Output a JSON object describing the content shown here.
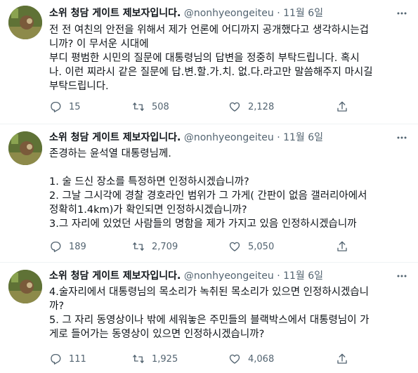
{
  "tweets": [
    {
      "name": "소위 청담 게이트 제보자입니다.",
      "handle": "@nonhyeongeiteu",
      "dot": "·",
      "date": "11월 6일",
      "lines": [
        "전 전 여친의 안전을 위해서 제가 언론에 어디까지 공개했다고 생각하시는겁",
        "니까? 이 무서운 시대에",
        "부디 평범한 시민의  질문에 대통령님의 답변을 정중히 부탁드립니다. 혹시",
        "나. 이런 찌라시 같은 질문에 답.변.할.가.치. 없.다.라고만 말씀해주지 마시길",
        "부탁드립니다."
      ],
      "replies": "15",
      "retweets": "508",
      "likes": "2,128"
    },
    {
      "name": "소위 청담 게이트 제보자입니다.",
      "handle": "@nonhyeongeiteu",
      "dot": "·",
      "date": "11월 6일",
      "lines": [
        "존경하는 윤석열 대통령님께.",
        "",
        "1. 술 드신 장소를 특정하면 인정하시겠습니까?",
        "2. 그날 그시각에 경찰 경호라인 범위가 그 가게( 간판이 없음 갤러리아에서",
        "정확히1.4km)가 확인되면 인정하시겠습니까?",
        "3.그 자리에 있었던 사람들의 명함을 제가 가지고 있음 인정하시겠습니까"
      ],
      "replies": "189",
      "retweets": "2,709",
      "likes": "5,050"
    },
    {
      "name": "소위 청담 게이트 제보자입니다.",
      "handle": "@nonhyeongeiteu",
      "dot": "·",
      "date": "11월 6일",
      "lines": [
        "4.술자리에서 대통령님의 목소리가 녹취된 목소리가 있으면 인정하시겠습니",
        "까?",
        "5. 그 자리 동영상이나 밖에 세워놓은 주민들의 블랙박스에서 대통령님이 가",
        "게로 들어가는 동영상이 있으면 인정하시겠습니까?"
      ],
      "replies": "111",
      "retweets": "1,925",
      "likes": "4,068"
    }
  ],
  "icons": {
    "reply": "reply-icon",
    "retweet": "retweet-icon",
    "like": "like-icon",
    "share": "share-icon",
    "more": "more-icon"
  },
  "colors": {
    "text": "#0f1419",
    "muted": "#536471",
    "divider": "#eff3f4"
  }
}
